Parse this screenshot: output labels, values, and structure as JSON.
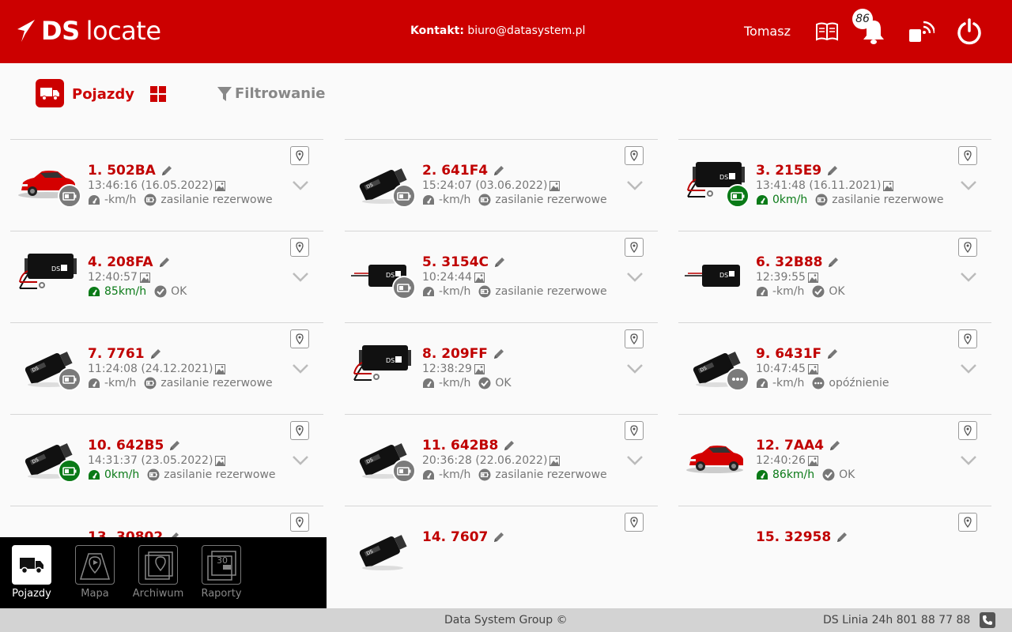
{
  "header": {
    "logo_ds": "DS",
    "logo_locate": "locate",
    "contact_label": "Kontakt:",
    "contact_email": "biuro@datasystem.pl",
    "user": "Tomasz",
    "notification_count": "86",
    "icons": [
      "book-icon",
      "bell-icon",
      "device-signal-icon",
      "power-icon"
    ]
  },
  "toolbar": {
    "vehicles_label": "Pojazdy",
    "filter_label": "Filtrowanie"
  },
  "vehicles": [
    {
      "title": "1. 502BA",
      "time": "13:46:16 (16.05.2022)",
      "speed": "-km/h",
      "speed_active": false,
      "status": "zasilanie rezerwowe",
      "status_icon": "battery",
      "thumb": "car",
      "circle": "gray"
    },
    {
      "title": "2. 641F4",
      "time": "15:24:07 (03.06.2022)",
      "speed": "-km/h",
      "speed_active": false,
      "status": "zasilanie rezerwowe",
      "status_icon": "battery",
      "thumb": "obd",
      "circle": "gray"
    },
    {
      "title": "3. 215E9",
      "time": "13:41:48 (16.11.2021)",
      "speed": "0km/h",
      "speed_active": true,
      "status": "zasilanie rezerwowe",
      "status_icon": "battery",
      "thumb": "box-wires",
      "circle": "green"
    },
    {
      "title": "4. 208FA",
      "time": "12:40:57",
      "speed": "85km/h",
      "speed_active": true,
      "status": "OK",
      "status_icon": "check",
      "thumb": "box-wires",
      "circle": "none"
    },
    {
      "title": "5. 3154C",
      "time": "10:24:44",
      "speed": "-km/h",
      "speed_active": false,
      "status": "zasilanie rezerwowe",
      "status_icon": "battery",
      "thumb": "box-flat",
      "circle": "gray"
    },
    {
      "title": "6. 32B88",
      "time": "12:39:55",
      "speed": "-km/h",
      "speed_active": false,
      "status": "OK",
      "status_icon": "check",
      "thumb": "box-flat",
      "circle": "none"
    },
    {
      "title": "7. 7761",
      "time": "11:24:08 (24.12.2021)",
      "speed": "-km/h",
      "speed_active": false,
      "status": "zasilanie rezerwowe",
      "status_icon": "battery",
      "thumb": "obd",
      "circle": "gray"
    },
    {
      "title": "8. 209FF",
      "time": "12:38:29",
      "speed": "-km/h",
      "speed_active": false,
      "status": "OK",
      "status_icon": "check",
      "thumb": "box-wires",
      "circle": "none"
    },
    {
      "title": "9. 6431F",
      "time": "10:47:45",
      "speed": "-km/h",
      "speed_active": false,
      "status": "opóźnienie",
      "status_icon": "dots",
      "thumb": "obd",
      "circle": "gray-dots"
    },
    {
      "title": "10. 642B5",
      "time": "14:31:37 (23.05.2022)",
      "speed": "0km/h",
      "speed_active": true,
      "status": "zasilanie rezerwowe",
      "status_icon": "battery",
      "thumb": "obd",
      "circle": "green"
    },
    {
      "title": "11. 642B8",
      "time": "20:36:28 (22.06.2022)",
      "speed": "-km/h",
      "speed_active": false,
      "status": "zasilanie rezerwowe",
      "status_icon": "battery",
      "thumb": "obd",
      "circle": "gray"
    },
    {
      "title": "12. 7AA4",
      "time": "12:40:26",
      "speed": "86km/h",
      "speed_active": true,
      "status": "OK",
      "status_icon": "check",
      "thumb": "car",
      "circle": "none"
    },
    {
      "title": "13. 30802",
      "time": "",
      "speed": "",
      "speed_active": false,
      "status": "",
      "status_icon": "",
      "thumb": "none",
      "circle": "none"
    },
    {
      "title": "14. 7607",
      "time": "",
      "speed": "",
      "speed_active": false,
      "status": "",
      "status_icon": "",
      "thumb": "obd-partial",
      "circle": "none"
    },
    {
      "title": "15. 32958",
      "time": "",
      "speed": "",
      "speed_active": false,
      "status": "",
      "status_icon": "",
      "thumb": "none",
      "circle": "none"
    }
  ],
  "bottom_nav": [
    {
      "label": "Pojazdy",
      "icon": "van-icon",
      "active": true
    },
    {
      "label": "Mapa",
      "icon": "map-icon",
      "active": false
    },
    {
      "label": "Archiwum",
      "icon": "archive-icon",
      "active": false
    },
    {
      "label": "Raporty",
      "icon": "reports-icon",
      "active": false,
      "icon_text": "30"
    }
  ],
  "footer": {
    "center": "Data System Group ©",
    "right": "DS Linia 24h 801 88 77 88"
  },
  "colors": {
    "brand_red": "#cc0000",
    "active_green": "#0a7a17",
    "muted_gray": "#777777"
  }
}
